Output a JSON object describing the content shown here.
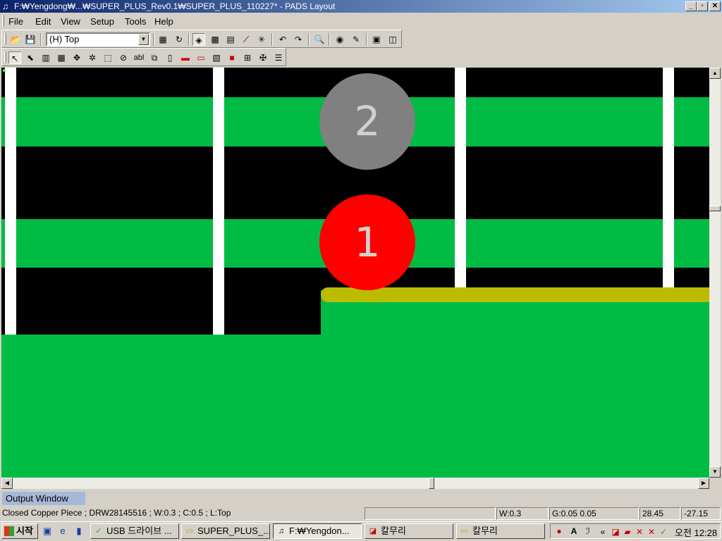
{
  "window": {
    "title": "F:₩Yengdong₩...₩SUPER_PLUS_Rev0.1₩SUPER_PLUS_110227* - PADS Layout",
    "min_glyph": "_",
    "max_glyph": "▫",
    "close_glyph": "✕"
  },
  "menu": {
    "items": [
      {
        "label": "File"
      },
      {
        "label": "Edit"
      },
      {
        "label": "View"
      },
      {
        "label": "Setup"
      },
      {
        "label": "Tools"
      },
      {
        "label": "Help"
      }
    ]
  },
  "toolbar": {
    "layer_select_value": "(H) Top",
    "icons_row1": [
      "open-icon",
      "save-icon",
      "properties-icon",
      "redraw-icon",
      "layer-display-icon",
      "pour-icon",
      "board-outline-icon",
      "route-icon",
      "cluster-icon",
      "undo-icon",
      "redo-icon",
      "zoom-icon",
      "view-icon",
      "paint-icon",
      "report-icon",
      "window-icon"
    ],
    "icons_row2": [
      "select-icon",
      "design-icon",
      "drafting-icon",
      "copper-icon",
      "copper-pour-icon",
      "hatch-icon",
      "keepout-icon",
      "delete-icon",
      "text-icon",
      "dimension-icon",
      "ecn-icon",
      "route-icon",
      "split-icon",
      "component-icon",
      "part-icon",
      "via-icon",
      "bom-icon"
    ],
    "text_tool_label": "abl"
  },
  "canvas": {
    "background": "#000000",
    "copper_color": "#00bb44",
    "trace_color": "#bbbb00",
    "keepout_color": "#ffffff",
    "pads": [
      {
        "label": "2",
        "color": "#808080",
        "text_color": "#d0d0d0"
      },
      {
        "label": "1",
        "color": "#ff0000",
        "text_color": "#d0d0d0"
      }
    ]
  },
  "output_window": {
    "label": "Output Window"
  },
  "status": {
    "message": "Closed Copper Piece ; DRW28145516 ; W:0.3 ; C:0.5 ; L:Top",
    "empty": "",
    "width": "W:0.3",
    "grid": "G:0.05 0.05",
    "x": "28.45",
    "y": "-27.15"
  },
  "taskbar": {
    "start_label": "시작",
    "tasks": [
      {
        "label": "USB 드라이브 ...",
        "icon": "usb-icon"
      },
      {
        "label": "SUPER_PLUS_...",
        "icon": "folder-icon"
      },
      {
        "label": "F:₩Yengdon...",
        "icon": "pads-icon",
        "active": true
      },
      {
        "label": "칼무리",
        "icon": "app-icon"
      },
      {
        "label": "칼무리",
        "icon": "folder-icon"
      }
    ],
    "tray_chevron": "«",
    "ime_label": "A",
    "clock": "오전 12:28"
  }
}
